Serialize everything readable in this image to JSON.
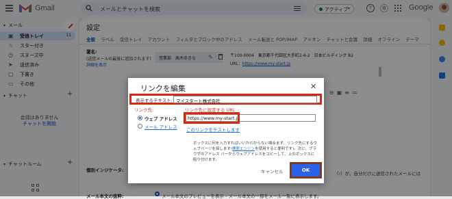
{
  "header": {
    "logo_text": "Gmail",
    "search_placeholder": "メールとチャットを検索",
    "status_label": "アクティブ",
    "brand": "Google"
  },
  "sidebar": {
    "mail_section": "メール",
    "items": [
      {
        "label": "受信トレイ",
        "count": "11",
        "icon": "inbox-icon"
      },
      {
        "label": "スター付き",
        "icon": "star-icon"
      },
      {
        "label": "スヌーズ中",
        "icon": "clock-icon"
      },
      {
        "label": "送信済み",
        "icon": "send-icon"
      },
      {
        "label": "下書き",
        "icon": "draft-icon"
      },
      {
        "label": "その他",
        "icon": "folder-icon"
      }
    ],
    "chat_section": "チャット",
    "chat_empty": "会話はありません",
    "chat_start": "チャットを開始",
    "chat_room_section": "チャットルーム"
  },
  "main": {
    "title": "設定",
    "tabs": [
      "全般",
      "ラベル",
      "受信トレイ",
      "アカウント",
      "フィルタとブロック中のアドレス",
      "メール転送と POP/IMAP",
      "アドオン",
      "チャットと会議",
      "詳細",
      "オフライン",
      "テーマ"
    ],
    "signature": {
      "label": "署名:",
      "note": "(送信メールの最後に追加されます)",
      "details_link": "詳細を表示",
      "entry_name": "営業部　高木ゆきな",
      "body_lines": [
        "〒100-0004　東京都千代田区大手町2-6-2　日本ビルディング B2",
        "URL："
      ],
      "body_url": "https://www.my-start.jp"
    },
    "indicator_label": "個別インジケータ:",
    "indicator_text": "（›）が、自分だけに送信されたメールには",
    "snippet_label": "メール本文の抜粋:",
    "snippet_text": "メール本文のプレビューを表示 - メール本文の一部をメール一覧に表示します。"
  },
  "dialog": {
    "title": "リンクを編集",
    "display_text_label": "表示するテキスト:",
    "display_text_value": "マイスタート株式会社",
    "link_target_label": "リンク先:",
    "link_target_hint": "リンク先に設定する URL",
    "radio_web": "ウェブ アドレス",
    "radio_email": "メール アドレス",
    "url_value": "https://www.my-start.jp",
    "test_link": "このリンクをテストします",
    "help_text_1": "ボックスに何を入力すればいいかわからない場合まず、リンク先にするウェブページを探します(",
    "help_link": "検索エンジン",
    "help_text_2": "を使用すると便利です)。次に、ブラウザのアドレス バーからウェブアドレスをコピーして、上のボックスに貼り付けます。",
    "cancel_label": "キャンセル",
    "ok_label": "OK"
  },
  "colors": {
    "highlight": "#d62a10",
    "ok_button": "#2a63e8",
    "link": "#1a66d8"
  }
}
